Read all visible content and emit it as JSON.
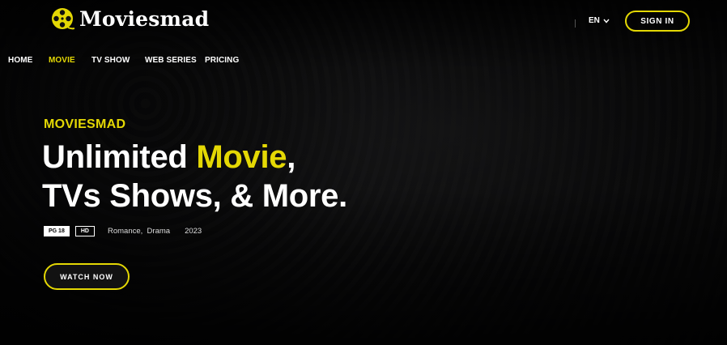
{
  "brand": {
    "name": "Moviesmad",
    "accent": "#e4d804"
  },
  "header": {
    "language": "EN",
    "signin_label": "SIGN IN"
  },
  "nav": [
    {
      "label": "HOME",
      "active": false
    },
    {
      "label": "MOVIE",
      "active": true
    },
    {
      "label": "TV SHOW",
      "active": false
    },
    {
      "label": "WEB SERIES",
      "active": false
    },
    {
      "label": "PRICING",
      "active": false
    }
  ],
  "hero": {
    "subtitle": "MOVIESMAD",
    "title_part1": "Unlimited ",
    "title_highlight": "Movie",
    "title_part2": ",",
    "title_line2": "TVs Shows, & More.",
    "rating_badge": "PG 18",
    "quality_badge": "HD",
    "genres": "Romance,  Drama",
    "year": "2023",
    "cta_label": "WATCH NOW"
  }
}
